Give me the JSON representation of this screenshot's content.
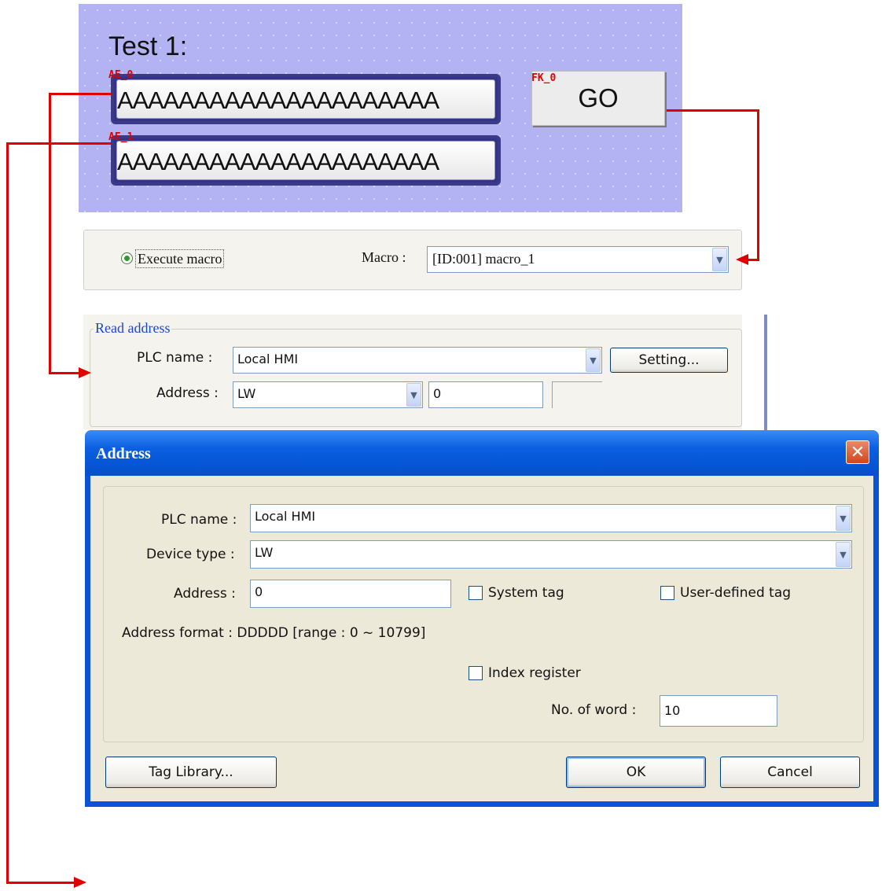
{
  "canvas": {
    "title": "Test 1:",
    "ae0_tag": "AE_0",
    "ae1_tag": "AE_1",
    "ae0_value": "AAAAAAAAAAAAAAAAAAAAA",
    "ae1_value": "AAAAAAAAAAAAAAAAAAAAA",
    "fk_tag": "FK_0",
    "go_label": "GO"
  },
  "macro_panel": {
    "execute_label": "Execute macro",
    "macro_label": "Macro :",
    "macro_value": "[ID:001] macro_1"
  },
  "read_address": {
    "legend": "Read address",
    "plc_label": "PLC name :",
    "plc_value": "Local HMI",
    "setting_label": "Setting...",
    "address_label": "Address :",
    "device_value": "LW",
    "address_value": "0"
  },
  "address_dialog": {
    "title": "Address",
    "close_symbol": "✕",
    "plc_label": "PLC name :",
    "plc_value": "Local HMI",
    "device_label": "Device type :",
    "device_value": "LW",
    "address_label": "Address :",
    "address_value": "0",
    "system_tag_label": "System tag",
    "user_tag_label": "User-defined tag",
    "format_text": "Address format : DDDDD [range : 0 ~ 10799]",
    "index_register_label": "Index register",
    "word_label": "No. of word :",
    "word_value": "10",
    "tag_library_label": "Tag Library...",
    "ok_label": "OK",
    "cancel_label": "Cancel"
  },
  "colors": {
    "connector": "#e00000",
    "canvas_bg": "#b3b3f4",
    "dialog_title": "#0a5fe0"
  },
  "icons": {
    "dropdown": "chevron-down-icon",
    "radio": "radio-selected-icon",
    "close": "close-icon"
  }
}
